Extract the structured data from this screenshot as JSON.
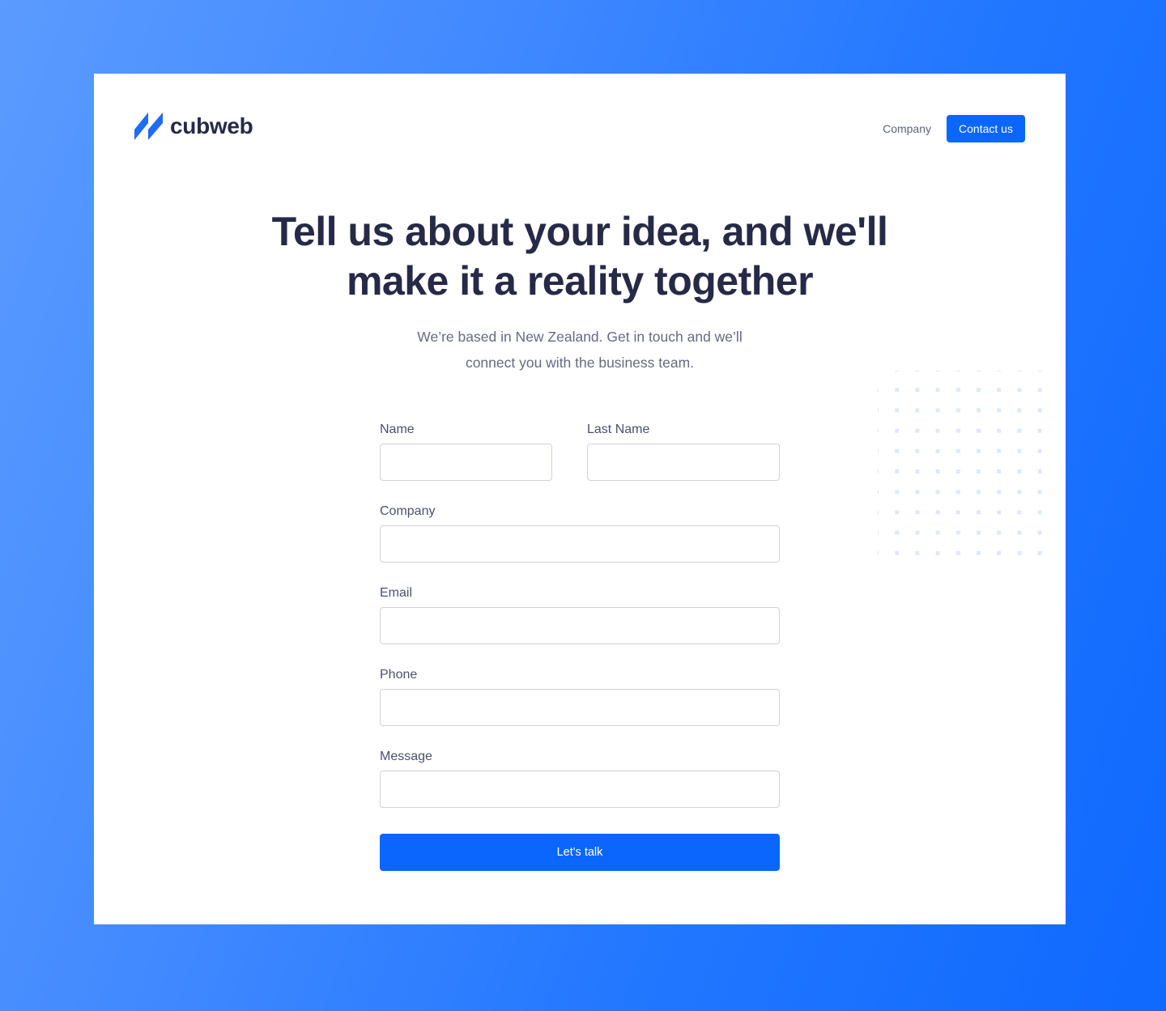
{
  "brand": {
    "name": "cubweb",
    "accent_color": "#0b66fe",
    "logo_icon": "cubweb-logo-icon"
  },
  "nav": {
    "company_label": "Company",
    "contact_label": "Contact us"
  },
  "hero": {
    "headline_line1": "Tell us about your idea, and we'll",
    "headline_line2": "make it a reality together",
    "subtitle_line1": "We’re based in New Zealand. Get in touch and we’ll",
    "subtitle_line2": "connect you with the business team."
  },
  "form": {
    "name": {
      "label": "Name",
      "value": "",
      "placeholder": ""
    },
    "last_name": {
      "label": "Last Name",
      "value": "",
      "placeholder": ""
    },
    "company": {
      "label": "Company",
      "value": "",
      "placeholder": ""
    },
    "email": {
      "label": "Email",
      "value": "",
      "placeholder": ""
    },
    "phone": {
      "label": "Phone",
      "value": "",
      "placeholder": ""
    },
    "message": {
      "label": "Message",
      "value": "",
      "placeholder": ""
    },
    "submit_label": "Let's talk"
  },
  "decoration": {
    "dot_grid_icon": "dot-grid-pattern",
    "dot_color": "#dde9fb"
  }
}
